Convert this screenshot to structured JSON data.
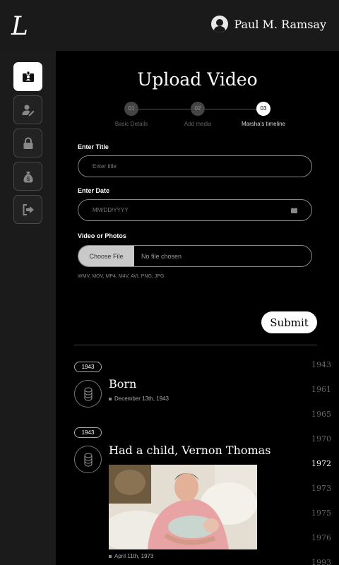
{
  "header": {
    "logo_text": "L",
    "user_name": "Paul M. Ramsay"
  },
  "sidebar": {
    "items": [
      {
        "icon": "id-badge-icon",
        "active": true
      },
      {
        "icon": "user-edit-icon",
        "active": false
      },
      {
        "icon": "lock-icon",
        "active": false
      },
      {
        "icon": "money-bag-icon",
        "active": false
      },
      {
        "icon": "logout-icon",
        "active": false
      }
    ]
  },
  "upload": {
    "title": "Upload Video",
    "steps": [
      {
        "number": "01",
        "label": "Basic Details",
        "active": false
      },
      {
        "number": "02",
        "label": "Add media",
        "active": false
      },
      {
        "number": "03",
        "label": "Marsha's timeline",
        "active": true
      }
    ],
    "title_label": "Enter Title",
    "title_placeholder": "Enter title",
    "date_label": "Enter Date",
    "date_placeholder": "MM/DD/YYYY",
    "media_label": "Video or Photos",
    "choose_file": "Choose File",
    "no_file": "No file chosen",
    "formats": "WMV, MOV, MP4, M4V, AVI, PNG, JPG",
    "submit": "Submit"
  },
  "timeline": {
    "events": [
      {
        "year": "1943",
        "title": "Born",
        "date": "December 13th, 1943"
      },
      {
        "year": "1943",
        "title": "Had a child, Vernon Thomas",
        "date": "April 11th, 1973"
      }
    ],
    "years": [
      "1943",
      "1961",
      "1965",
      "1970",
      "1972",
      "1973",
      "1975",
      "1976",
      "1993"
    ],
    "current_year": "1972"
  },
  "colors": {
    "background": "#000000",
    "topbar": "#1a1a1a",
    "sidebar": "#1b1b1b",
    "accent": "#ffffff"
  }
}
